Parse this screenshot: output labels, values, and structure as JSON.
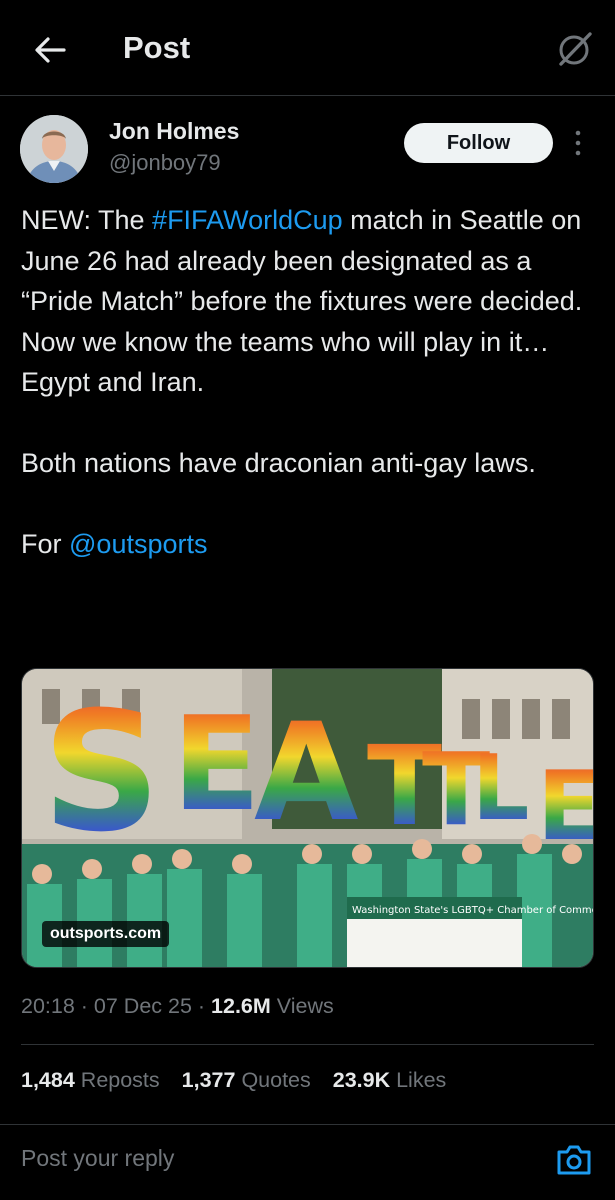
{
  "header": {
    "title": "Post",
    "back_icon": "arrow-left-icon",
    "grok_icon": "grok-icon"
  },
  "author": {
    "name": "Jon Holmes",
    "handle": "@jonboy79",
    "follow_label": "Follow",
    "more_icon": "more-vertical-icon"
  },
  "tweet": {
    "p1_a": "NEW: The ",
    "hashtag": "#FIFAWorldCup",
    "p1_b": " match in Seattle on June 26 had already been designated as a “Pride Match” before the fixtures were decided. Now we know the teams who will play in it… Egypt and Iran.",
    "p2": "Both nations have draconian anti-gay laws.",
    "p3_a": "For ",
    "mention": "@outsports"
  },
  "media": {
    "source_label": "outsports.com",
    "sign_letters": [
      "S",
      "E",
      "A",
      "T",
      "T",
      "L",
      "E"
    ],
    "banner_text": "Washington State's LGBTQ+ Chamber of Commerce"
  },
  "meta": {
    "time": "20:18",
    "sep1": " · ",
    "date": "07 Dec 25",
    "sep2": " · ",
    "views_count": "12.6M",
    "views_label": " Views"
  },
  "stats": {
    "reposts_count": "1,484",
    "reposts_label": " Reposts",
    "quotes_count": "1,377",
    "quotes_label": " Quotes",
    "likes_count": "23.9K",
    "likes_label": " Likes"
  },
  "reply": {
    "placeholder": "Post your reply",
    "camera_icon": "camera-icon"
  },
  "colors": {
    "background": "#000000",
    "text": "#e7e9ea",
    "secondary": "#71767b",
    "accent": "#1d9bf0",
    "border": "#2f3336"
  }
}
